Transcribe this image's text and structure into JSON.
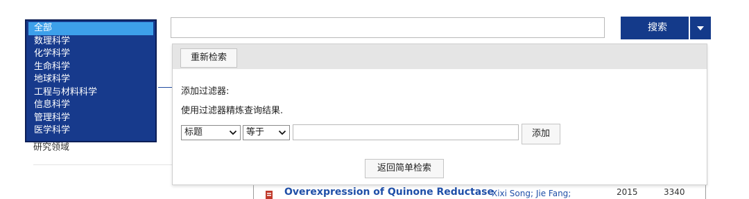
{
  "subject_select": {
    "options": [
      "全部",
      "数理科学",
      "化学科学",
      "生命科学",
      "地球科学",
      "工程与材料科学",
      "信息科学",
      "管理科学",
      "医学科学"
    ],
    "selected": "全部"
  },
  "background": {
    "sidebar_label": "研究领域"
  },
  "search": {
    "value": "",
    "button_label": "搜索"
  },
  "advanced": {
    "reset_label": "重新检索",
    "add_filter_label": "添加过滤器:",
    "hint": "使用过滤器精炼查询结果.",
    "field_select": "标题",
    "operator_select": "等于",
    "filter_value": "",
    "add_label": "添加",
    "back_simple_label": "返回简单检索"
  },
  "result": {
    "icon": "pdf-icon",
    "title": "Overexpression of Quinone Reductase",
    "authors": "Xixi Song; Jie Fang;",
    "year": "2015",
    "count": "3340"
  },
  "colors": {
    "brand": "#143a8a",
    "selected_option": "#3da0ea",
    "link": "#1f4fa8"
  }
}
